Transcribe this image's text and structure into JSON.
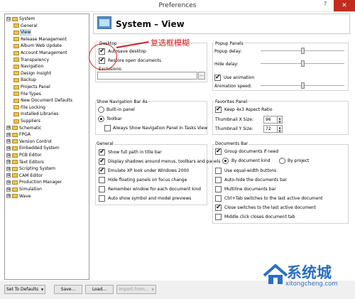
{
  "window": {
    "title": "Preferences",
    "help_glyph": "?",
    "close_glyph": "✕"
  },
  "tree": {
    "items": [
      {
        "label": "System",
        "expander": "⊟",
        "top": true
      },
      {
        "label": "General"
      },
      {
        "label": "View",
        "selected": true
      },
      {
        "label": "Release Management"
      },
      {
        "label": "Album Web Update"
      },
      {
        "label": "Account Management"
      },
      {
        "label": "Transparency"
      },
      {
        "label": "Navigation"
      },
      {
        "label": "Design Insight"
      },
      {
        "label": "Backup"
      },
      {
        "label": "Projects Panel"
      },
      {
        "label": "File Types"
      },
      {
        "label": "New Document Defaults"
      },
      {
        "label": "File Locking"
      },
      {
        "label": "Installed Libraries"
      },
      {
        "label": "Suppliers"
      },
      {
        "label": "Schematic",
        "expander": "⊞",
        "top": true
      },
      {
        "label": "FPGA",
        "expander": "⊞",
        "top": true
      },
      {
        "label": "Version Control",
        "expander": "⊞",
        "top": true
      },
      {
        "label": "Embedded System",
        "expander": "⊞",
        "top": true
      },
      {
        "label": "PCB Editor",
        "expander": "⊞",
        "top": true
      },
      {
        "label": "Text Editors",
        "expander": "⊞",
        "top": true
      },
      {
        "label": "Scripting System",
        "expander": "⊞",
        "top": true
      },
      {
        "label": "CAM Editor",
        "expander": "⊞",
        "top": true
      },
      {
        "label": "Production Manager",
        "expander": "⊞",
        "top": true
      },
      {
        "label": "Simulation",
        "expander": "⊞",
        "top": true
      },
      {
        "label": "Wave",
        "expander": "⊞",
        "top": true
      }
    ]
  },
  "header": {
    "title": "System – View"
  },
  "annotation": {
    "text": "复选框模糊"
  },
  "desktop": {
    "label": "Desktop",
    "autosave": {
      "label": "Autosave desktop",
      "checked": true
    },
    "restore": {
      "label": "Restore open documents",
      "checked": true
    },
    "exclusions_label": "Exclusions:",
    "exclusions_value": "",
    "browse_label": "..."
  },
  "popup_panels": {
    "label": "Popup Panels",
    "popup_delay_label": "Popup delay:",
    "popup_delay_level": 0.5,
    "hide_delay_label": "Hide delay:",
    "hide_delay_level": 0.5,
    "use_animation": {
      "label": "Use animation",
      "checked": true
    },
    "animation_speed_label": "Animation speed:",
    "animation_speed_level": 0.5
  },
  "nav_bar": {
    "label": "Show Navigation Bar As",
    "builtin": {
      "label": "Built-in panel",
      "selected": false
    },
    "toolbar": {
      "label": "Toolbar",
      "selected": true
    },
    "always_show": {
      "label": "Always Show Navigation Panel In Tasks View",
      "checked": false
    }
  },
  "favorites": {
    "label": "Favorites Panel",
    "keep_ratio": {
      "label": "Keep 4x3 Aspect Ratio",
      "checked": true
    },
    "thumb_x_label": "Thumbnail X Size:",
    "thumb_x_value": "96",
    "thumb_y_label": "Thumbnail Y Size:",
    "thumb_y_value": "72",
    "spin_up": "▲",
    "spin_down": "▼"
  },
  "general": {
    "label": "General",
    "options": [
      {
        "label": "Show full path in title bar",
        "checked": true
      },
      {
        "label": "Display shadows around menus, toolbars and panels",
        "checked": true
      },
      {
        "label": "Emulate XP look under Windows 2000",
        "checked": true
      },
      {
        "label": "Hide floating panels on focus change",
        "checked": false
      },
      {
        "label": "Remember window for each document kind",
        "checked": false
      },
      {
        "label": "Auto show symbol and model previews",
        "checked": false
      }
    ]
  },
  "documents_bar": {
    "label": "Documents Bar",
    "group_docs": {
      "label": "Group documents if need",
      "checked": true
    },
    "by_kind": {
      "label": "By document kind",
      "selected": true
    },
    "by_project": {
      "label": "By project",
      "selected": false
    },
    "options": [
      {
        "label": "Use equal-width buttons",
        "checked": false
      },
      {
        "label": "Auto-hide the documents bar",
        "checked": false
      },
      {
        "label": "Multiline documents bar",
        "checked": false
      },
      {
        "label": "Ctrl+Tab switches to the last active document",
        "checked": false
      },
      {
        "label": "Close switches to the last active document",
        "checked": true
      },
      {
        "label": "Middle click closes document tab",
        "checked": false
      }
    ]
  },
  "footer": {
    "set_defaults": "Set To Defaults",
    "dropdown_glyph": "▼",
    "save": "Save...",
    "load": "Load...",
    "import_from": "Import From..."
  },
  "watermark": {
    "cn": "系统城",
    "url": "xitongcheng.com"
  },
  "colors": {
    "accent": "#2c6fbf",
    "annotation": "#d02020",
    "selection": "#cfe3f7"
  }
}
